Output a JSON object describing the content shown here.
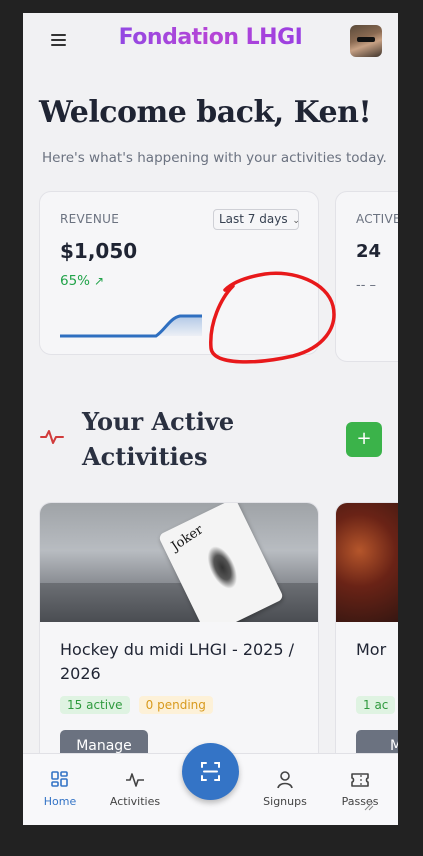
{
  "app": {
    "title": "Fondation LHGI",
    "avatar_icon": "user-avatar"
  },
  "colors": {
    "accent_blue": "#3474c6",
    "brand_purple": "#7c3aed",
    "success_green": "#22a34a",
    "add_button_green": "#3bb34a",
    "pending_amber": "#d89a1e",
    "annotation_red": "#e8191b"
  },
  "welcome": {
    "heading": "Welcome back, Ken!",
    "subtitle": "Here's what's happening with your activities today."
  },
  "stats": {
    "revenue": {
      "label": "REVENUE",
      "range": "Last 7 days",
      "value": "$1,050",
      "change": "65%",
      "trend_icon": "trending-up-icon",
      "sparkline_data": [
        0,
        0,
        0,
        0,
        0,
        0,
        0.1,
        1,
        1
      ]
    },
    "active": {
      "label": "ACTIVE",
      "value": "24",
      "change": "-- –"
    }
  },
  "section": {
    "title": "Your Active Activities",
    "icon": "pulse-icon",
    "add_label": "+"
  },
  "activities": [
    {
      "title": "Hockey du midi LHGI - 2025 / 2026",
      "active": "15 active",
      "pending": "0 pending",
      "manage": "Manage",
      "card_text": "Joker"
    },
    {
      "title": "Mor",
      "active": "1 ac",
      "manage": "M"
    }
  ],
  "nav": {
    "home": "Home",
    "activities": "Activities",
    "signups": "Signups",
    "passes": "Passes",
    "scan_icon": "scan-icon"
  }
}
